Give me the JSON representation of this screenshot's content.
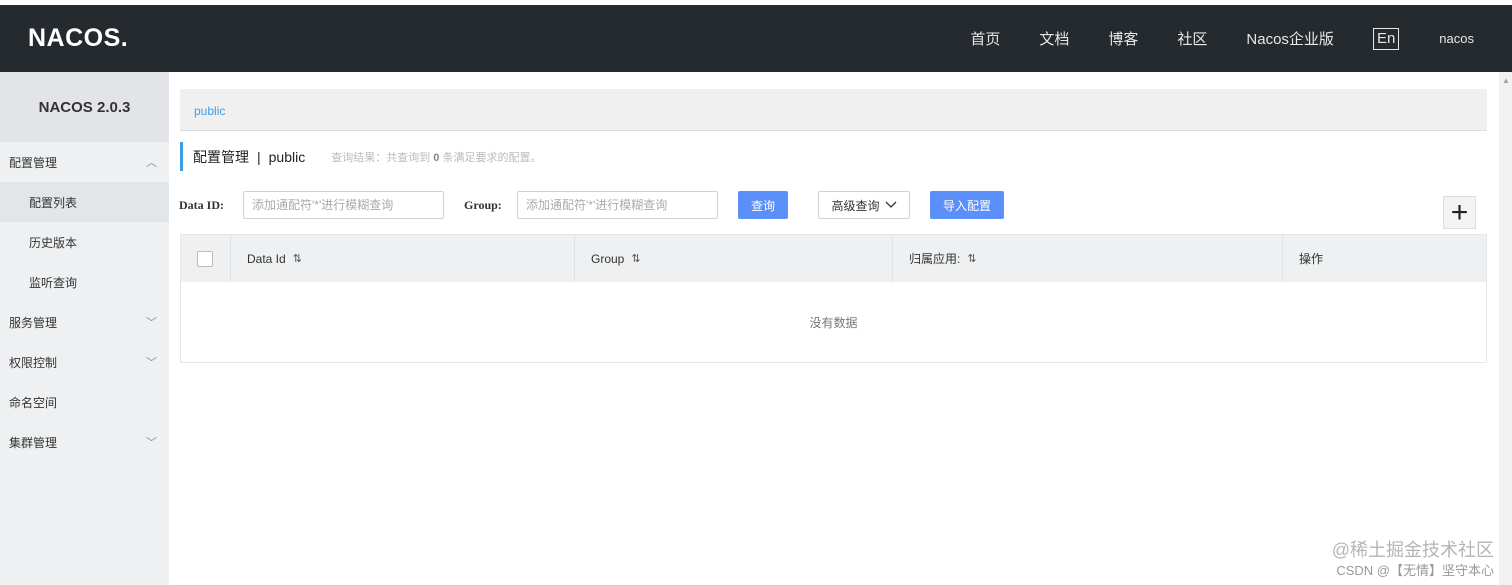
{
  "topbar": {
    "logo": "NACOS.",
    "nav": [
      "首页",
      "文档",
      "博客",
      "社区",
      "Nacos企业版"
    ],
    "lang": "En",
    "user": "nacos"
  },
  "sidebar": {
    "version": "NACOS 2.0.3",
    "groups": [
      {
        "label": "配置管理",
        "arrow": "︿",
        "children": [
          "配置列表",
          "历史版本",
          "监听查询"
        ]
      },
      {
        "label": "服务管理",
        "arrow": "﹀"
      },
      {
        "label": "权限控制",
        "arrow": "﹀"
      },
      {
        "label": "命名空间"
      },
      {
        "label": "集群管理",
        "arrow": "﹀"
      }
    ]
  },
  "breadcrumb": {
    "namespace": "public"
  },
  "heading": {
    "title": "配置管理",
    "separator": "|",
    "namespace": "public",
    "result_prefix": "查询结果：共查询到",
    "result_count": "0",
    "result_suffix": "条满足要求的配置。"
  },
  "filters": {
    "data_id_label": "Data ID:",
    "data_id_placeholder": "添加通配符'*'进行模糊查询",
    "group_label": "Group:",
    "group_placeholder": "添加通配符'*'进行模糊查询",
    "query_button": "查询",
    "advanced_button": "高级查询",
    "import_button": "导入配置",
    "add_button": "+"
  },
  "table": {
    "columns": [
      "Data Id",
      "Group",
      "归属应用:",
      "操作"
    ],
    "sort_icon": "⇅",
    "empty_text": "没有数据"
  },
  "watermark": {
    "line1": "@稀土掘金技术社区",
    "line2": "CSDN @【无情】坚守本心"
  },
  "colors": {
    "accent": "#5b8ff9",
    "link": "#3c9ee5",
    "topbar": "#252a2f"
  }
}
